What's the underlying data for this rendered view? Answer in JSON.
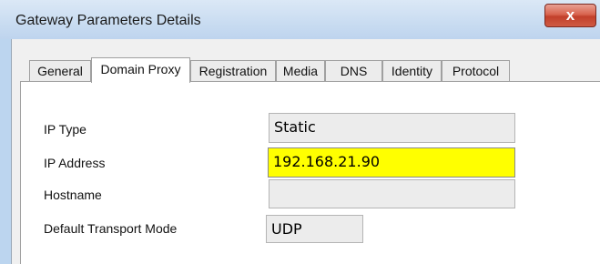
{
  "window": {
    "title": "Gateway Parameters Details",
    "close_glyph": "x"
  },
  "tabs": [
    {
      "label": "General"
    },
    {
      "label": "Domain Proxy"
    },
    {
      "label": "Registration"
    },
    {
      "label": "Media"
    },
    {
      "label": "DNS"
    },
    {
      "label": "Identity"
    },
    {
      "label": "Protocol"
    }
  ],
  "active_tab": "Domain Proxy",
  "form": {
    "ip_type": {
      "label": "IP Type",
      "value": "Static"
    },
    "ip_address": {
      "label": "IP Address",
      "value": "192.168.21.90"
    },
    "hostname": {
      "label": "Hostname",
      "value": ""
    },
    "transport": {
      "label": "Default Transport Mode",
      "value": "UDP"
    }
  },
  "colors": {
    "highlight": "#ffff00",
    "close_button": "#c9503a"
  }
}
